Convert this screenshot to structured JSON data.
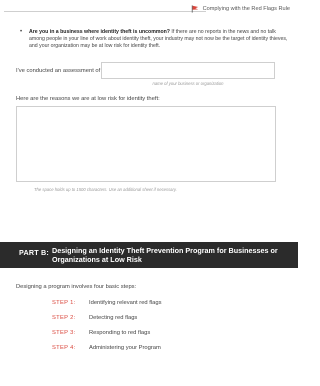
{
  "header": {
    "title": "Complying with the Red Flags Rule",
    "icon": "red-flag-icon",
    "accent": "#d9453b"
  },
  "bullet": {
    "lead": "Are you in a business where identity theft is uncommon?",
    "text": " If there are no reports in the news and no talk among people in your line of work about identity theft, your industry may not now be the target of identity thieves, and your organization may be at low risk for identity theft."
  },
  "assessment": {
    "label": "I've conducted an assessment of",
    "caption": "name of your business or organization"
  },
  "reasons": {
    "label": "Here are the reasons we are at low risk for identity theft:",
    "caption": "The space holds up to 1500 characters. Use an additional sheet if necessary."
  },
  "part": {
    "tag": "PART B:",
    "title": "Designing an Identity Theft Prevention Program for Businesses or Organizations at Low Risk"
  },
  "steps": {
    "intro": "Designing a program involves four basic steps:",
    "items": [
      {
        "tag": "STEP 1:",
        "text": "Identifying relevant red flags"
      },
      {
        "tag": "STEP 2:",
        "text": "Detecting red flags"
      },
      {
        "tag": "STEP 3:",
        "text": "Responding to red flags"
      },
      {
        "tag": "STEP 4:",
        "text": "Administering your Program"
      }
    ]
  }
}
